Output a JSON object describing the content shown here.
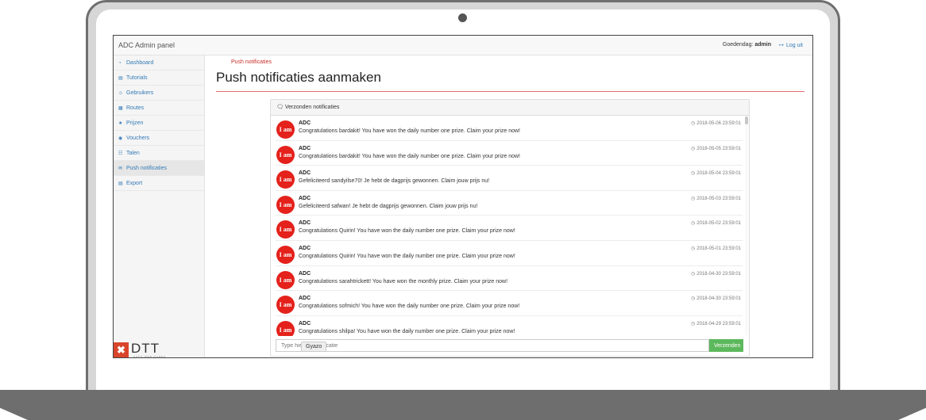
{
  "navbar": {
    "brand": "ADC Admin panel",
    "greeting_prefix": "Goedendag:",
    "username": "admin",
    "logout_label": "Log uit"
  },
  "sidebar": {
    "items": [
      {
        "label": "Dashboard",
        "icon": "dashboard-icon"
      },
      {
        "label": "Tutorials",
        "icon": "book-icon"
      },
      {
        "label": "Gebruikers",
        "icon": "users-icon"
      },
      {
        "label": "Routes",
        "icon": "map-icon"
      },
      {
        "label": "Prijzen",
        "icon": "trophy-icon"
      },
      {
        "label": "Vouchers",
        "icon": "gift-icon"
      },
      {
        "label": "Talen",
        "icon": "language-icon"
      },
      {
        "label": "Push notificaties",
        "icon": "chat-icon",
        "active": true
      },
      {
        "label": "Export",
        "icon": "file-icon"
      }
    ],
    "logo": "DTT",
    "logo_sub": "APPS WEB GAMES"
  },
  "main": {
    "breadcrumb": "Push notificaties",
    "title": "Push notificaties aanmaken",
    "panel_title": "Verzonden notificaties",
    "avatar_text": "I am",
    "messages": [
      {
        "sender": "ADC",
        "text": "Congratulations bardakit! You have won the daily number one prize. Claim your prize now!",
        "time": "2018-05-06 23:59:01"
      },
      {
        "sender": "ADC",
        "text": "Congratulations bardakit! You have won the daily number one prize. Claim your prize now!",
        "time": "2018-05-05 23:59:01"
      },
      {
        "sender": "ADC",
        "text": "Gefeliciteerd sandyilse70! Je hebt de dagprijs gewonnen. Claim jouw prijs nu!",
        "time": "2018-05-04 23:59:01"
      },
      {
        "sender": "ADC",
        "text": "Gefeliciteerd safwan! Je hebt de dagprijs gewonnen. Claim jouw prijs nu!",
        "time": "2018-05-03 23:59:01"
      },
      {
        "sender": "ADC",
        "text": "Congratulations Quirin! You have won the daily number one prize. Claim your prize now!",
        "time": "2018-05-02 23:59:01"
      },
      {
        "sender": "ADC",
        "text": "Congratulations Quirin! You have won the daily number one prize. Claim your prize now!",
        "time": "2018-05-01 23:59:01"
      },
      {
        "sender": "ADC",
        "text": "Congratulations sarahtrickett! You have won the monthly prize. Claim your prize now!",
        "time": "2018-04-30 23:59:01"
      },
      {
        "sender": "ADC",
        "text": "Congratulations sofmich! You have won the daily number one prize. Claim your prize now!",
        "time": "2018-04-30 23:59:01"
      },
      {
        "sender": "ADC",
        "text": "Congratulations shilpa! You have won the daily number one prize. Claim your prize now!",
        "time": "2018-04-29 23:59:01"
      }
    ],
    "input_placeholder": "Type hier uw notificatie",
    "send_label": "Verzenden",
    "gyazo_label": "Gyazo"
  },
  "colors": {
    "avatar": "#e4211b",
    "send_button": "#5cb85c",
    "link": "#337ab7",
    "breadcrumb": "#c9302c"
  }
}
